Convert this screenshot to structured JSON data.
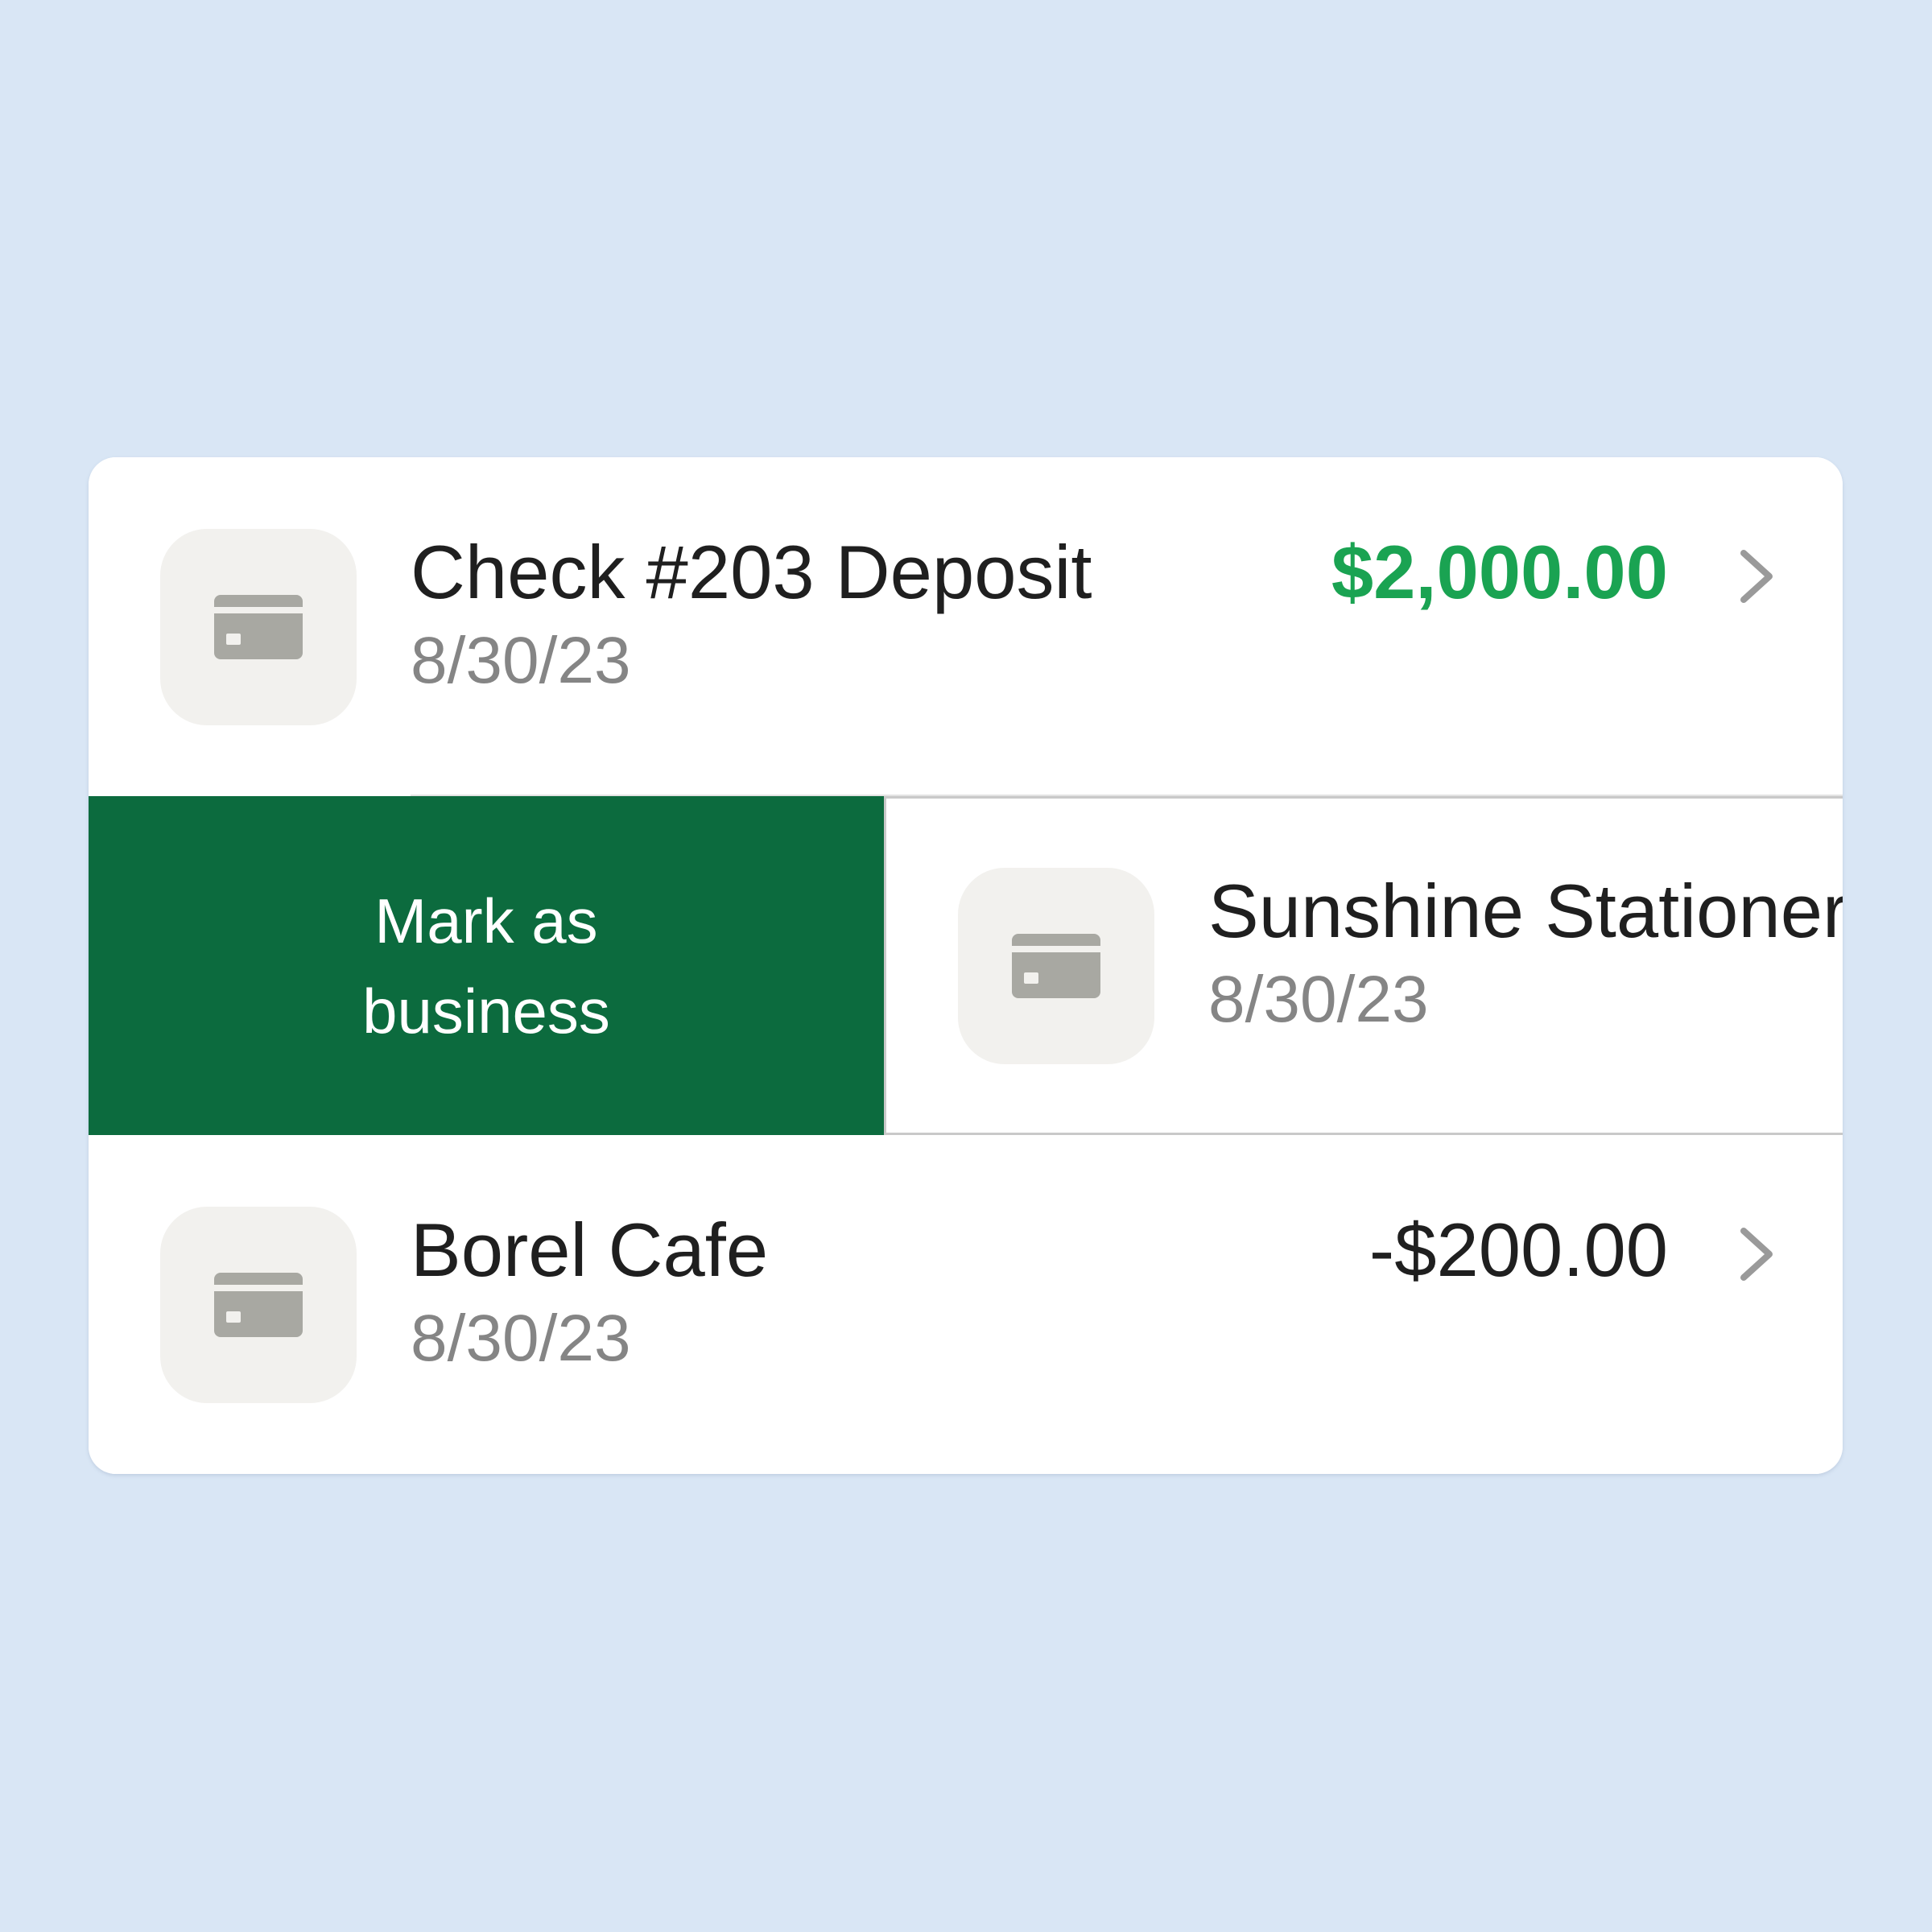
{
  "transactions": [
    {
      "title": "Check #203 Deposit",
      "date": "8/30/23",
      "amount": "$2,000.00",
      "amount_type": "credit",
      "icon": "credit-card-icon"
    },
    {
      "title": "Sunshine Stationery",
      "date": "8/30/23",
      "icon": "credit-card-icon",
      "swipe_action": {
        "label": "Mark as\nbusiness",
        "color": "#0c6b3e"
      }
    },
    {
      "title": "Borel Cafe",
      "date": "8/30/23",
      "amount": "-$200.00",
      "amount_type": "debit",
      "icon": "credit-card-icon"
    }
  ],
  "colors": {
    "background": "#d9e6f5",
    "credit_amount": "#1aa352",
    "icon_tile": "#f2f1ee",
    "icon_glyph": "#a8a8a2",
    "date_text": "#858585"
  }
}
